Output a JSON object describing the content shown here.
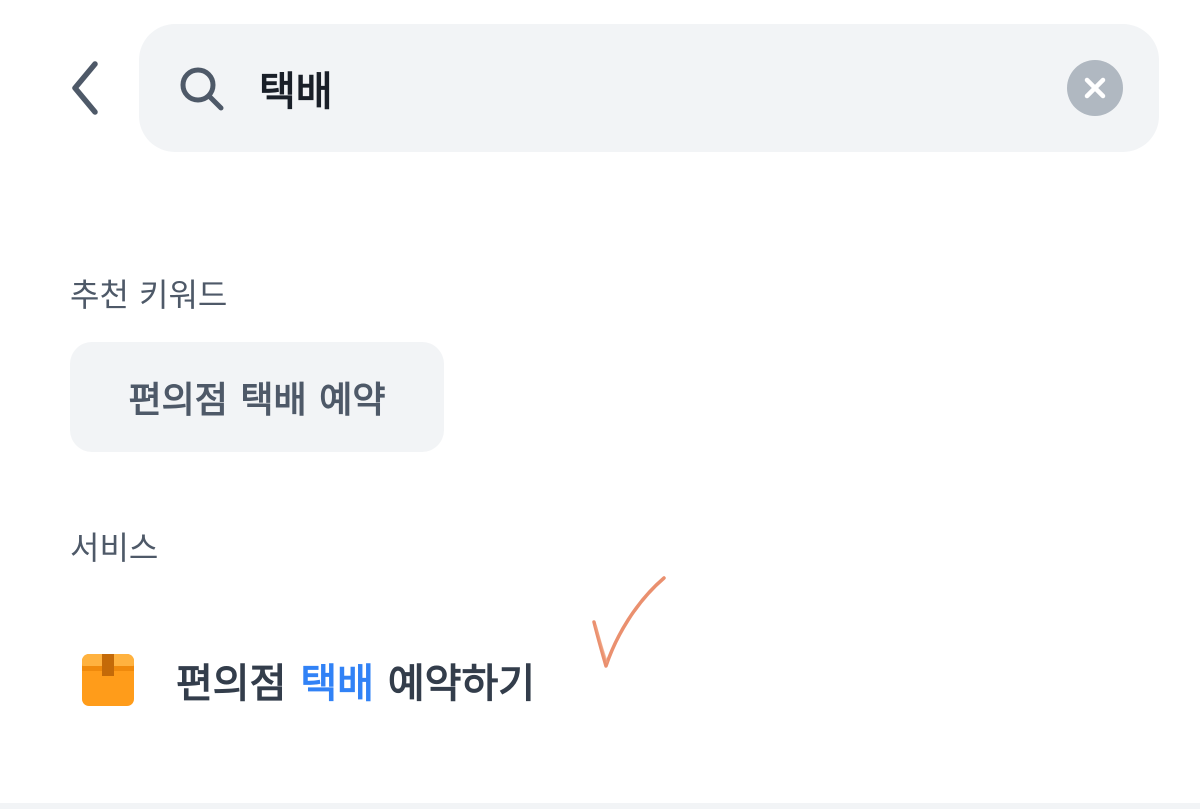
{
  "header": {
    "search": {
      "value": "택배",
      "placeholder": ""
    }
  },
  "recommended": {
    "title": "추천 키워드",
    "keywords": [
      "편의점 택배 예약"
    ]
  },
  "services": {
    "title": "서비스",
    "items": [
      {
        "label_before": "편의점 ",
        "label_highlight": "택배",
        "label_after": " 예약하기",
        "icon": "package-box-icon"
      }
    ]
  },
  "colors": {
    "highlight": "#3182f6",
    "chip_background": "#f2f4f6",
    "icon_orange": "#ff9c1a",
    "annotation_check": "#e8845f"
  }
}
